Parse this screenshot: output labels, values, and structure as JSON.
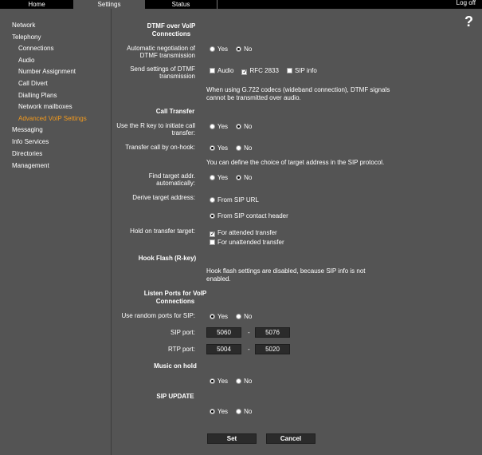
{
  "tabs": {
    "home": "Home",
    "settings": "Settings",
    "status": "Status"
  },
  "logoff": "Log off",
  "help_glyph": "?",
  "sidebar": {
    "network": "Network",
    "telephony": "Telephony",
    "connections": "Connections",
    "audio": "Audio",
    "number_assignment": "Number Assignment",
    "call_divert": "Call Divert",
    "dialling_plans": "Dialling Plans",
    "network_mailboxes": "Network mailboxes",
    "advanced_voip": "Advanced VoIP Settings",
    "messaging": "Messaging",
    "info_services": "Info Services",
    "directories": "Directories",
    "management": "Management"
  },
  "dtmf": {
    "title_line1": "DTMF over VoIP",
    "title_line2": "Connections",
    "auto_neg_line1": "Automatic negotiation of",
    "auto_neg_line2": "DTMF transmission",
    "send_line1": "Send settings of DTMF",
    "send_line2": "transmission",
    "opt_audio": "Audio",
    "opt_rfc": "RFC 2833",
    "opt_sipinfo": "SIP info",
    "note_line1": "When using G.722 codecs (wideband connection), DTMF signals",
    "note_line2": "cannot be transmitted over audio."
  },
  "call_transfer": {
    "title": "Call Transfer",
    "rkey_line1": "Use the R key to initiate call",
    "rkey_line2": "transfer:",
    "onhook": "Transfer call by on-hook:",
    "note": "You can define the choice of target address in the SIP protocol.",
    "find_line1": "Find target addr.",
    "find_line2": "automatically:",
    "derive": "Derive target address:",
    "opt_sip_url": "From SIP URL",
    "opt_sip_contact": "From SIP contact header",
    "hold": "Hold on transfer target:",
    "opt_attended": "For attended transfer",
    "opt_unattended": "For unattended transfer"
  },
  "hook_flash": {
    "title": "Hook Flash (R-key)",
    "note_line1": "Hook flash settings are disabled, because SIP info is not",
    "note_line2": "enabled."
  },
  "listen_ports": {
    "title_line1": "Listen Ports for VoIP",
    "title_line2": "Connections",
    "random": "Use random ports for SIP:",
    "sip_port": "SIP port:",
    "rtp_port": "RTP port:",
    "sip_from": "5060",
    "sip_to": "5076",
    "rtp_from": "5004",
    "rtp_to": "5020",
    "dash": "-"
  },
  "music_on_hold": {
    "title": "Music on hold"
  },
  "sip_update": {
    "title": "SIP UPDATE"
  },
  "yes": "Yes",
  "no": "No",
  "buttons": {
    "set": "Set",
    "cancel": "Cancel"
  },
  "checkmark": "✓"
}
